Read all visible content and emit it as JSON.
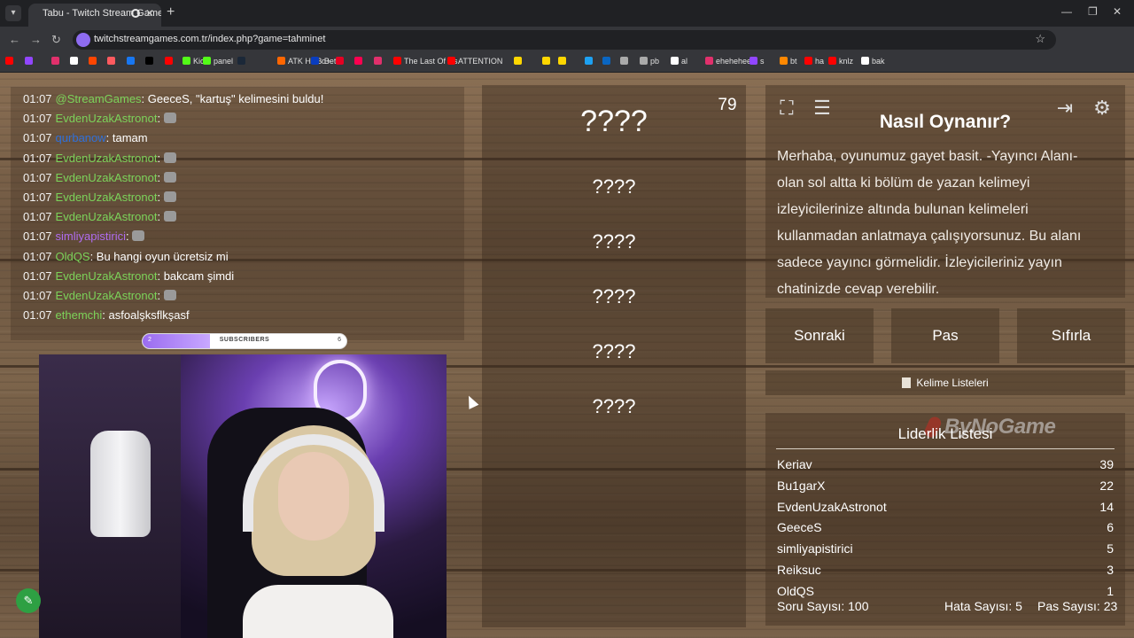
{
  "browser": {
    "tab_title": "Tabu - Twitch Stream Game",
    "url": "twitchstreamgames.com.tr/index.php?game=tahminet",
    "bookmarks": [
      {
        "label": "",
        "color": "#ff0000"
      },
      {
        "label": "",
        "color": "#9146ff"
      },
      {
        "label": "",
        "color": "#e1306c"
      },
      {
        "label": "",
        "color": "#ffffff"
      },
      {
        "label": "",
        "color": "#ff4500"
      },
      {
        "label": "",
        "color": "#ff5a5f"
      },
      {
        "label": "",
        "color": "#1877f2"
      },
      {
        "label": "",
        "color": "#000000"
      },
      {
        "label": "",
        "color": "#ff0000"
      },
      {
        "label": "Kick",
        "color": "#53fc18"
      },
      {
        "label": "panel",
        "color": "#53fc18"
      },
      {
        "label": "",
        "color": "#1b2838"
      },
      {
        "label": "ATK HUB Beta",
        "color": "#ff6600"
      },
      {
        "label": "d+",
        "color": "#0a3dbe"
      },
      {
        "label": "",
        "color": "#e60023"
      },
      {
        "label": "",
        "color": "#ff0050"
      },
      {
        "label": "",
        "color": "#e1306c"
      },
      {
        "label": "The Last Of Us",
        "color": "#ff0000"
      },
      {
        "label": "ATTENTION",
        "color": "#ff0000"
      },
      {
        "label": "",
        "color": "#ffd700"
      },
      {
        "label": "",
        "color": "#ffd700"
      },
      {
        "label": "",
        "color": "#ffd700"
      },
      {
        "label": "",
        "color": "#1da1f2"
      },
      {
        "label": "",
        "color": "#0a66c2"
      },
      {
        "label": "",
        "color": "#aaaaaa"
      },
      {
        "label": "pb",
        "color": "#aaaaaa"
      },
      {
        "label": "al",
        "color": "#ffffff"
      },
      {
        "label": "ehehehee",
        "color": "#e1306c"
      },
      {
        "label": "s",
        "color": "#9146ff"
      },
      {
        "label": "bt",
        "color": "#ff8800"
      },
      {
        "label": "ha",
        "color": "#ff0000"
      },
      {
        "label": "knlz",
        "color": "#ff0000"
      },
      {
        "label": "bak",
        "color": "#ffffff"
      }
    ]
  },
  "chat": {
    "messages": [
      {
        "time": "01:07",
        "user": "@StreamGames",
        "color": "#7cd35a",
        "text": "GeeceS, \"kartuş\" kelimesini buldu!",
        "emote": false
      },
      {
        "time": "01:07",
        "user": "EvdenUzakAstronot",
        "color": "#7cd35a",
        "text": "",
        "emote": true
      },
      {
        "time": "01:07",
        "user": "qurbanow",
        "color": "#2f6fd8",
        "text": "tamam",
        "emote": false
      },
      {
        "time": "01:07",
        "user": "EvdenUzakAstronot",
        "color": "#7cd35a",
        "text": "",
        "emote": true
      },
      {
        "time": "01:07",
        "user": "EvdenUzakAstronot",
        "color": "#7cd35a",
        "text": "",
        "emote": true
      },
      {
        "time": "01:07",
        "user": "EvdenUzakAstronot",
        "color": "#7cd35a",
        "text": "",
        "emote": true
      },
      {
        "time": "01:07",
        "user": "EvdenUzakAstronot",
        "color": "#7cd35a",
        "text": "",
        "emote": true
      },
      {
        "time": "01:07",
        "user": "simliyapistirici",
        "color": "#b06cf0",
        "text": "",
        "emote": true
      },
      {
        "time": "01:07",
        "user": "OldQS",
        "color": "#7cd35a",
        "text": "Bu hangi oyun ücretsiz mi",
        "emote": false
      },
      {
        "time": "01:07",
        "user": "EvdenUzakAstronot",
        "color": "#7cd35a",
        "text": "bakcam şimdi",
        "emote": false
      },
      {
        "time": "01:07",
        "user": "EvdenUzakAstronot",
        "color": "#7cd35a",
        "text": "",
        "emote": true
      },
      {
        "time": "01:07",
        "user": "ethemchi",
        "color": "#7cd35a",
        "text": "asfoalşksflkşasf",
        "emote": false
      }
    ]
  },
  "subscribers": {
    "label": "SUBSCRIBERS",
    "current": "2",
    "goal": "6",
    "progress": 0.33
  },
  "game": {
    "timer": "79",
    "words": [
      "????",
      "????",
      "????",
      "????",
      "????",
      "????"
    ]
  },
  "help": {
    "title": "Nasıl Oynanır?",
    "text": "Merhaba, oyunumuz gayet basit. -Yayıncı Alanı- olan sol altta ki bölüm de yazan kelimeyi izleyicilerinize altında bulunan kelimeleri kullanmadan anlatmaya çalışıyorsunuz. Bu alanı sadece yayıncı görmelidir. İzleyicileriniz yayın chatinizde cevap verebilir."
  },
  "actions": {
    "next": "Sonraki",
    "pass": "Pas",
    "reset": "Sıfırla",
    "word_lists": "Kelime Listeleri"
  },
  "watermark": "ByNoGame",
  "leaderboard": {
    "title": "Liderlik Listesi",
    "rows": [
      {
        "name": "Keriav",
        "score": "39"
      },
      {
        "name": "Bu1garX",
        "score": "22"
      },
      {
        "name": "EvdenUzakAstronot",
        "score": "14"
      },
      {
        "name": "GeeceS",
        "score": "6"
      },
      {
        "name": "simliyapistirici",
        "score": "5"
      },
      {
        "name": "Reiksuc",
        "score": "3"
      },
      {
        "name": "OldQS",
        "score": "1"
      }
    ]
  },
  "stats": {
    "questions": "Soru Sayısı: 100",
    "errors": "Hata Sayısı: 5",
    "passes": "Pas Sayısı: 23"
  }
}
